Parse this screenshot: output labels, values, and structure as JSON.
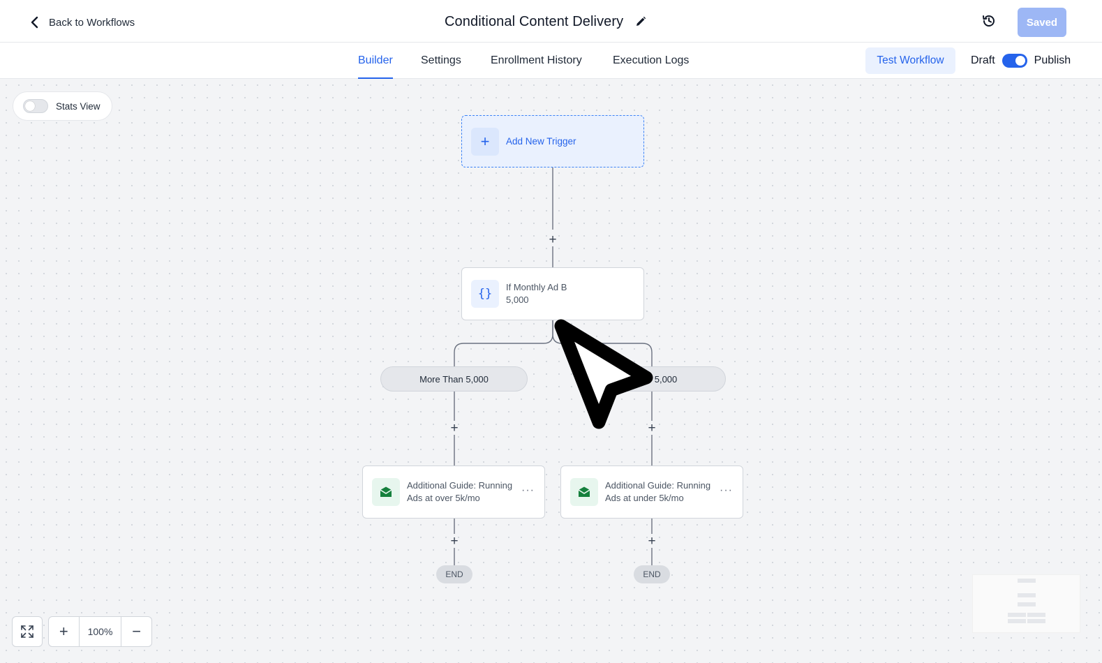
{
  "header": {
    "back_label": "Back to Workflows",
    "title": "Conditional Content Delivery",
    "saved_label": "Saved"
  },
  "tabs": [
    {
      "label": "Builder",
      "active": true
    },
    {
      "label": "Settings",
      "active": false
    },
    {
      "label": "Enrollment History",
      "active": false
    },
    {
      "label": "Execution Logs",
      "active": false
    }
  ],
  "actions": {
    "test_label": "Test Workflow",
    "draft_label": "Draft",
    "publish_label": "Publish",
    "publish_on": true
  },
  "canvas": {
    "stats_label": "Stats View",
    "stats_on": false,
    "trigger_label": "Add New Trigger",
    "condition_line1": "If Monthly Ad B",
    "condition_line2": "5,000",
    "branches": [
      {
        "label": "More Than 5,000",
        "action_line1": "Additional Guide: Running",
        "action_line2": "Ads at over 5k/mo",
        "end_label": "END"
      },
      {
        "label": "Under 5,000",
        "action_line1": "Additional Guide: Running",
        "action_line2": "Ads at under 5k/mo",
        "end_label": "END"
      }
    ]
  },
  "zoom": {
    "value": "100%"
  },
  "icons": {
    "back": "chevron-left-icon",
    "edit": "pencil-icon",
    "history": "history-icon",
    "trigger": "plus-icon",
    "condition": "braces-icon",
    "email": "email-icon",
    "fit": "fit-screen-icon"
  },
  "colors": {
    "accent": "#2563eb",
    "saved_btn": "#9db7f5",
    "email_icon": "#15803d"
  }
}
